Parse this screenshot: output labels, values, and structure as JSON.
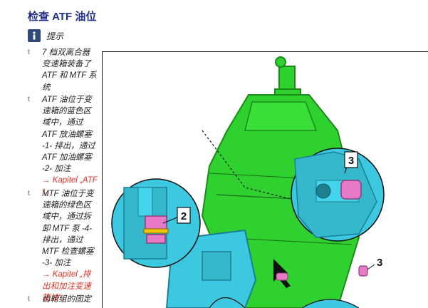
{
  "page": {
    "title": "检查 ATF 油位",
    "note_label": "提示"
  },
  "bullets": [
    {
      "mark": "t",
      "lines": [
        "7 档双离合器",
        "变速箱装备了",
        "ATF 和 MTF 系",
        "统"
      ]
    },
    {
      "mark": "t",
      "lines": [
        "ATF 油位于变",
        "速箱的蓝色区",
        "域中，通过",
        "ATF 放油螺塞",
        "-1- 排出，通过",
        "ATF 加油螺塞",
        "-2- 加注"
      ],
      "link_lines": [
        "→ Kapitel „ATF",
        "“。"
      ]
    },
    {
      "mark": "t",
      "lines": [
        "MTF 油位于变",
        "速箱的绿色区",
        "域中，通过拆",
        "卸 MTF 泵 -4-",
        "排出，通过",
        "MTF 检查螺塞",
        "-3- 加注"
      ],
      "link_lines": [
        "→ Kapitel „排",
        "出和加注变速",
        "箱油“。"
      ]
    },
    {
      "mark": "t",
      "lines": [
        "齿轮组的固定"
      ]
    }
  ],
  "figure": {
    "callouts": [
      "2",
      "3",
      "3"
    ],
    "colors": {
      "green": "#2fd12f",
      "green_dark": "#1a8a1a",
      "blue": "#3cc8e0",
      "blue_dark": "#1a7f95",
      "pink": "#e67ac6"
    }
  }
}
